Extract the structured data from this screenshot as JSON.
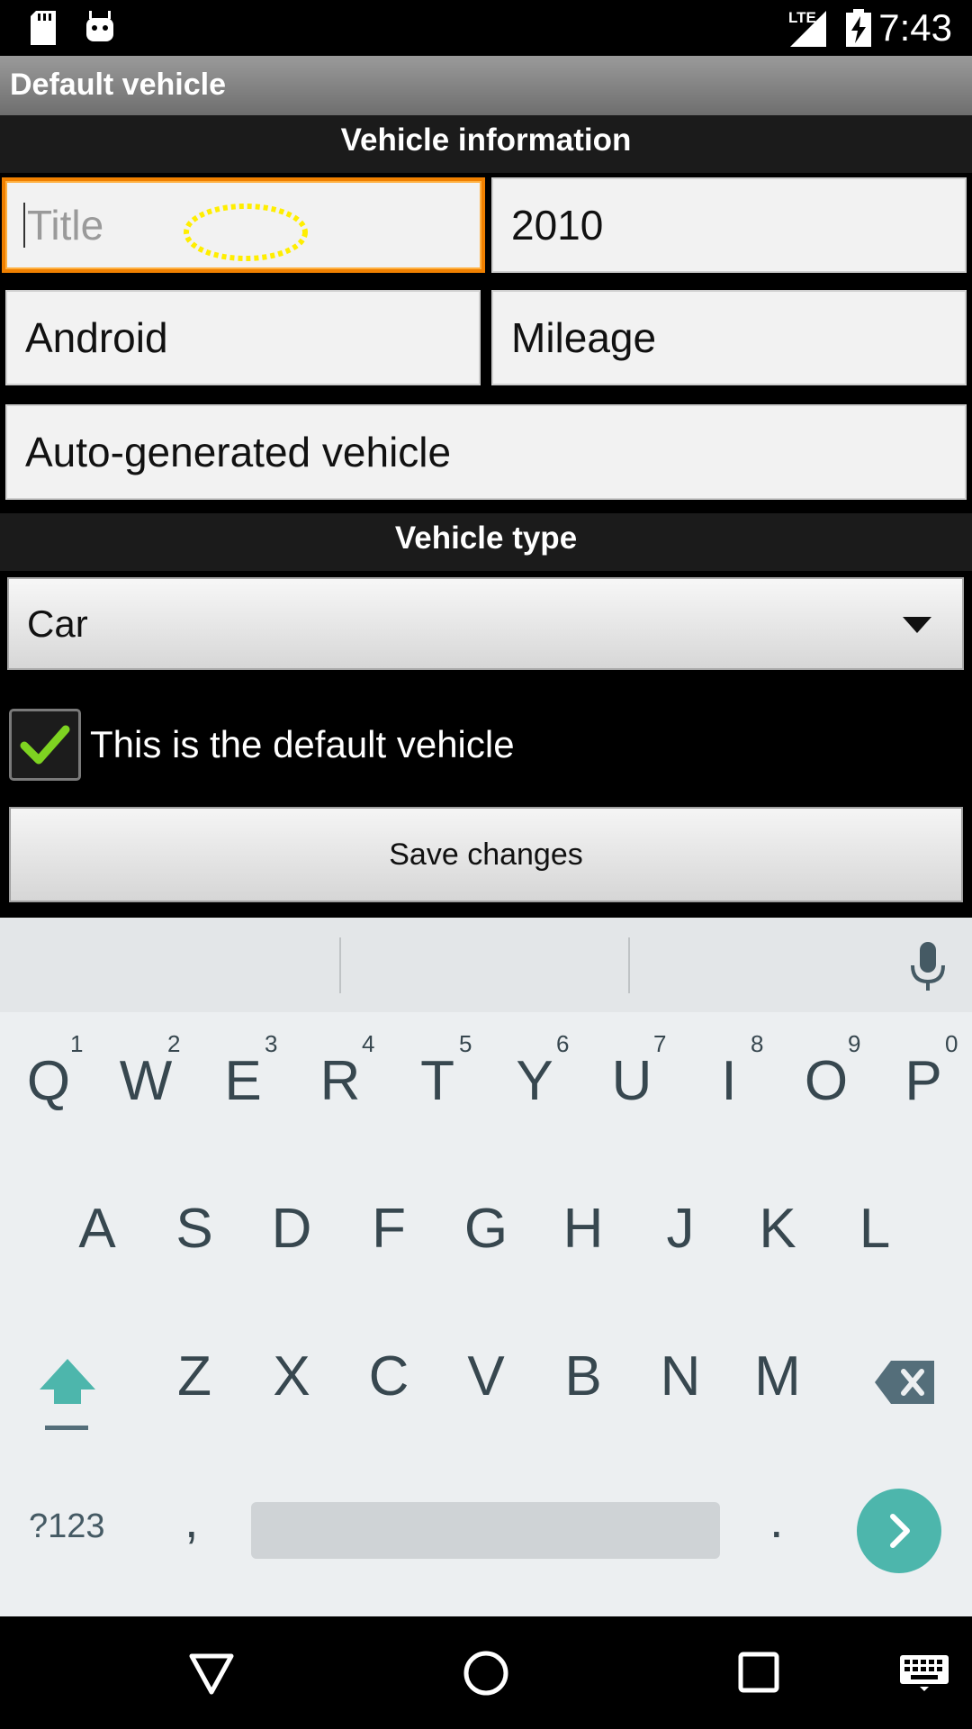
{
  "status_bar": {
    "time": "7:43",
    "network": "LTE",
    "icons": [
      "sd-card-icon",
      "android-icon",
      "signal-icon",
      "battery-charging-icon"
    ]
  },
  "title_bar": {
    "title": "Default vehicle"
  },
  "sections": {
    "vehicle_information": "Vehicle information",
    "vehicle_type": "Vehicle type"
  },
  "form": {
    "title_placeholder": "Title",
    "year_value": "2010",
    "make_value": "Android",
    "mileage_placeholder": "Mileage",
    "description_value": "Auto-generated vehicle",
    "vehicle_type_selected": "Car",
    "default_checkbox_label": "This is the default vehicle",
    "default_checked": true,
    "save_label": "Save changes"
  },
  "keyboard": {
    "row1": [
      "Q",
      "W",
      "E",
      "R",
      "T",
      "Y",
      "U",
      "I",
      "O",
      "P"
    ],
    "row1_hints": [
      "1",
      "2",
      "3",
      "4",
      "5",
      "6",
      "7",
      "8",
      "9",
      "0"
    ],
    "row2": [
      "A",
      "S",
      "D",
      "F",
      "G",
      "H",
      "J",
      "K",
      "L"
    ],
    "row3": [
      "Z",
      "X",
      "C",
      "V",
      "B",
      "N",
      "M"
    ],
    "symbols_label": "?123",
    "comma": ",",
    "period": ".",
    "accent_color": "#4db6ac"
  }
}
